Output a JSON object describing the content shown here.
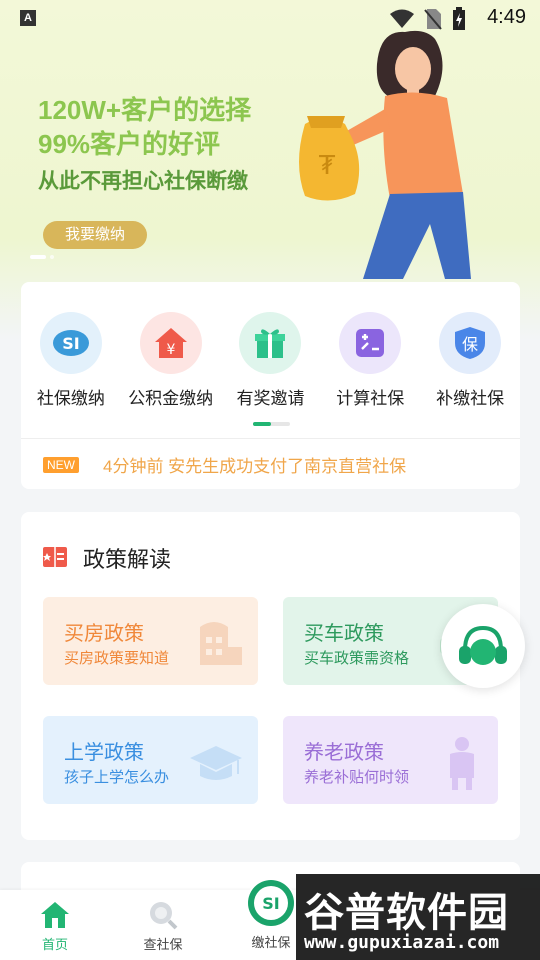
{
  "status_bar": {
    "time": "4:49",
    "indicator": "A"
  },
  "banner": {
    "line1": "120W+客户的选择",
    "line2": "99%客户的好评",
    "line3": "从此不再担心社保断缴",
    "button": "我要缴纳",
    "active_slide": 1
  },
  "services": [
    {
      "label": "社保缴纳",
      "icon": "si-logo-icon",
      "glyph": "SI"
    },
    {
      "label": "公积金缴纳",
      "icon": "house-yen-icon",
      "glyph": "¥"
    },
    {
      "label": "有奖邀请",
      "icon": "gift-icon",
      "glyph": ""
    },
    {
      "label": "计算社保",
      "icon": "calculator-icon",
      "glyph": ""
    },
    {
      "label": "补缴社保",
      "icon": "shield-bao-icon",
      "glyph": "保"
    }
  ],
  "news": {
    "badge": "NEW",
    "text": "4分钟前 安先生成功支付了南京直营社保"
  },
  "policy": {
    "title": "政策解读",
    "items": [
      {
        "title": "买房政策",
        "subtitle": "买房政策要知道",
        "icon": "building-icon",
        "color": "#f0883a"
      },
      {
        "title": "买车政策",
        "subtitle": "买车政策需资格",
        "icon": "car-icon",
        "color": "#2e9a5e"
      },
      {
        "title": "上学政策",
        "subtitle": "孩子上学怎么办",
        "icon": "graduation-cap-icon",
        "color": "#3a8fe0"
      },
      {
        "title": "养老政策",
        "subtitle": "养老补贴何时领",
        "icon": "elderly-icon",
        "color": "#9a6ed6"
      }
    ]
  },
  "tabs": [
    {
      "label": "首页",
      "icon": "home-icon",
      "active": true
    },
    {
      "label": "查社保",
      "icon": "search-icon",
      "active": false
    },
    {
      "label": "缴社保",
      "icon": "si-logo-icon",
      "active": false
    }
  ],
  "watermark": {
    "brand": "谷普软件园",
    "url": "www.gupuxiazai.com"
  },
  "colors": {
    "accent": "#22b573",
    "banner_text": "#8cc64f",
    "news_text": "#f0a64a"
  }
}
